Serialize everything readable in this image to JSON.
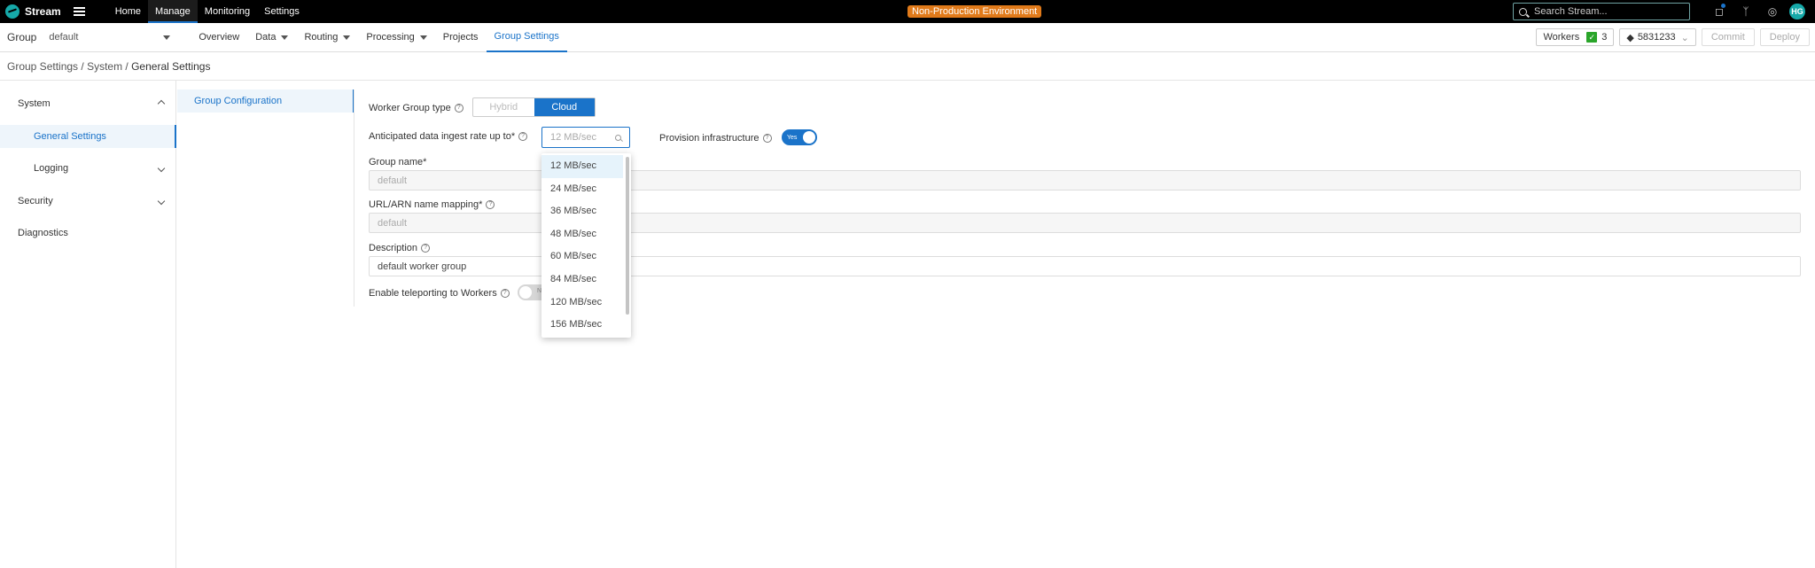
{
  "topbar": {
    "app_name": "Stream",
    "nav": [
      "Home",
      "Manage",
      "Monitoring",
      "Settings"
    ],
    "active_nav": "Manage",
    "env_badge": "Non-Production Environment",
    "search_placeholder": "Search Stream...",
    "user_initials": "HG",
    "accent_color": "#1a73c9",
    "badge_color": "#e07a1a"
  },
  "subbar": {
    "group_label": "Group",
    "group_value": "default",
    "tabs": [
      {
        "label": "Overview",
        "has_menu": false
      },
      {
        "label": "Data",
        "has_menu": true
      },
      {
        "label": "Routing",
        "has_menu": true
      },
      {
        "label": "Processing",
        "has_menu": true
      },
      {
        "label": "Projects",
        "has_menu": false
      },
      {
        "label": "Group Settings",
        "has_menu": false
      }
    ],
    "active_tab": "Group Settings",
    "workers_label": "Workers",
    "workers_count": "3",
    "commit_id": "5831233",
    "commit_label": "Commit",
    "deploy_label": "Deploy"
  },
  "breadcrumb": {
    "part1": "Group Settings",
    "part2": "System",
    "part3": "General Settings",
    "separator": " / "
  },
  "sidebar": {
    "system": "System",
    "general_settings": "General Settings",
    "logging": "Logging",
    "security": "Security",
    "diagnostics": "Diagnostics"
  },
  "subpanel": {
    "item": "Group Configuration"
  },
  "form": {
    "worker_group_type_label": "Worker Group type",
    "type_options": [
      "Hybrid",
      "Cloud"
    ],
    "selected_type": "Cloud",
    "ingest_label": "Anticipated data ingest rate up to*",
    "ingest_value": "12 MB/sec",
    "provision_label": "Provision infrastructure",
    "provision_toggle": "Yes",
    "group_name_label": "Group name*",
    "group_name_value": "default",
    "url_label": "URL/ARN name mapping*",
    "url_value": "default",
    "description_label": "Description",
    "description_value": "default worker group",
    "teleport_label": "Enable teleporting to Workers",
    "teleport_toggle": "No"
  },
  "dropdown": {
    "options": [
      "12 MB/sec",
      "24 MB/sec",
      "36 MB/sec",
      "48 MB/sec",
      "60 MB/sec",
      "84 MB/sec",
      "120 MB/sec",
      "156 MB/sec"
    ],
    "selected": "12 MB/sec"
  }
}
